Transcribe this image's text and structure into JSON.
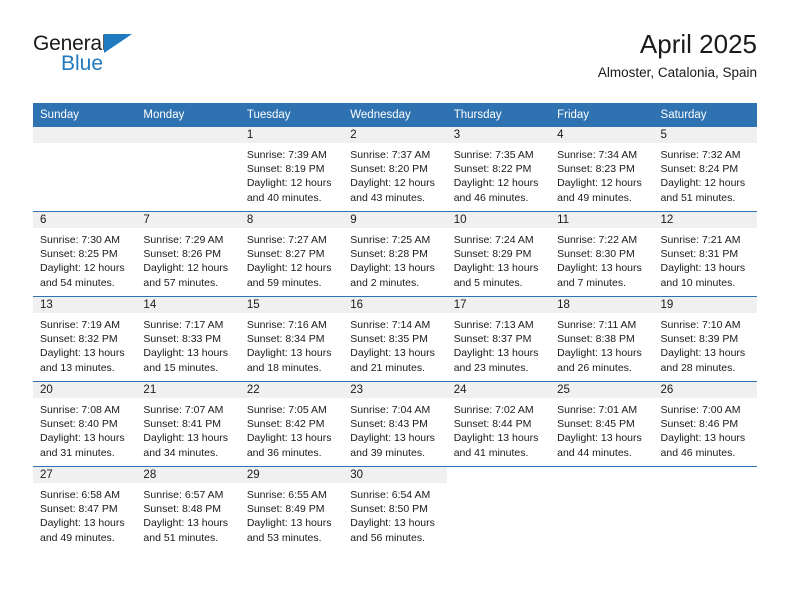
{
  "brand": {
    "name_top": "General",
    "name_bottom": "Blue",
    "accent_color": "#1f7ac0"
  },
  "header": {
    "title": "April 2025",
    "subtitle": "Almoster, Catalonia, Spain"
  },
  "theme": {
    "header_blue": "#2e72b2",
    "daynum_strip": "#f0f0f0",
    "text": "#1a1a1a"
  },
  "calendar": {
    "weekday_headers": [
      "Sunday",
      "Monday",
      "Tuesday",
      "Wednesday",
      "Thursday",
      "Friday",
      "Saturday"
    ],
    "weeks": [
      [
        {
          "day": "",
          "lines": [],
          "empty": true
        },
        {
          "day": "",
          "lines": [],
          "empty": true
        },
        {
          "day": "1",
          "lines": [
            "Sunrise: 7:39 AM",
            "Sunset: 8:19 PM",
            "Daylight: 12 hours",
            "and 40 minutes."
          ]
        },
        {
          "day": "2",
          "lines": [
            "Sunrise: 7:37 AM",
            "Sunset: 8:20 PM",
            "Daylight: 12 hours",
            "and 43 minutes."
          ]
        },
        {
          "day": "3",
          "lines": [
            "Sunrise: 7:35 AM",
            "Sunset: 8:22 PM",
            "Daylight: 12 hours",
            "and 46 minutes."
          ]
        },
        {
          "day": "4",
          "lines": [
            "Sunrise: 7:34 AM",
            "Sunset: 8:23 PM",
            "Daylight: 12 hours",
            "and 49 minutes."
          ]
        },
        {
          "day": "5",
          "lines": [
            "Sunrise: 7:32 AM",
            "Sunset: 8:24 PM",
            "Daylight: 12 hours",
            "and 51 minutes."
          ]
        }
      ],
      [
        {
          "day": "6",
          "lines": [
            "Sunrise: 7:30 AM",
            "Sunset: 8:25 PM",
            "Daylight: 12 hours",
            "and 54 minutes."
          ]
        },
        {
          "day": "7",
          "lines": [
            "Sunrise: 7:29 AM",
            "Sunset: 8:26 PM",
            "Daylight: 12 hours",
            "and 57 minutes."
          ]
        },
        {
          "day": "8",
          "lines": [
            "Sunrise: 7:27 AM",
            "Sunset: 8:27 PM",
            "Daylight: 12 hours",
            "and 59 minutes."
          ]
        },
        {
          "day": "9",
          "lines": [
            "Sunrise: 7:25 AM",
            "Sunset: 8:28 PM",
            "Daylight: 13 hours",
            "and 2 minutes."
          ]
        },
        {
          "day": "10",
          "lines": [
            "Sunrise: 7:24 AM",
            "Sunset: 8:29 PM",
            "Daylight: 13 hours",
            "and 5 minutes."
          ]
        },
        {
          "day": "11",
          "lines": [
            "Sunrise: 7:22 AM",
            "Sunset: 8:30 PM",
            "Daylight: 13 hours",
            "and 7 minutes."
          ]
        },
        {
          "day": "12",
          "lines": [
            "Sunrise: 7:21 AM",
            "Sunset: 8:31 PM",
            "Daylight: 13 hours",
            "and 10 minutes."
          ]
        }
      ],
      [
        {
          "day": "13",
          "lines": [
            "Sunrise: 7:19 AM",
            "Sunset: 8:32 PM",
            "Daylight: 13 hours",
            "and 13 minutes."
          ]
        },
        {
          "day": "14",
          "lines": [
            "Sunrise: 7:17 AM",
            "Sunset: 8:33 PM",
            "Daylight: 13 hours",
            "and 15 minutes."
          ]
        },
        {
          "day": "15",
          "lines": [
            "Sunrise: 7:16 AM",
            "Sunset: 8:34 PM",
            "Daylight: 13 hours",
            "and 18 minutes."
          ]
        },
        {
          "day": "16",
          "lines": [
            "Sunrise: 7:14 AM",
            "Sunset: 8:35 PM",
            "Daylight: 13 hours",
            "and 21 minutes."
          ]
        },
        {
          "day": "17",
          "lines": [
            "Sunrise: 7:13 AM",
            "Sunset: 8:37 PM",
            "Daylight: 13 hours",
            "and 23 minutes."
          ]
        },
        {
          "day": "18",
          "lines": [
            "Sunrise: 7:11 AM",
            "Sunset: 8:38 PM",
            "Daylight: 13 hours",
            "and 26 minutes."
          ]
        },
        {
          "day": "19",
          "lines": [
            "Sunrise: 7:10 AM",
            "Sunset: 8:39 PM",
            "Daylight: 13 hours",
            "and 28 minutes."
          ]
        }
      ],
      [
        {
          "day": "20",
          "lines": [
            "Sunrise: 7:08 AM",
            "Sunset: 8:40 PM",
            "Daylight: 13 hours",
            "and 31 minutes."
          ]
        },
        {
          "day": "21",
          "lines": [
            "Sunrise: 7:07 AM",
            "Sunset: 8:41 PM",
            "Daylight: 13 hours",
            "and 34 minutes."
          ]
        },
        {
          "day": "22",
          "lines": [
            "Sunrise: 7:05 AM",
            "Sunset: 8:42 PM",
            "Daylight: 13 hours",
            "and 36 minutes."
          ]
        },
        {
          "day": "23",
          "lines": [
            "Sunrise: 7:04 AM",
            "Sunset: 8:43 PM",
            "Daylight: 13 hours",
            "and 39 minutes."
          ]
        },
        {
          "day": "24",
          "lines": [
            "Sunrise: 7:02 AM",
            "Sunset: 8:44 PM",
            "Daylight: 13 hours",
            "and 41 minutes."
          ]
        },
        {
          "day": "25",
          "lines": [
            "Sunrise: 7:01 AM",
            "Sunset: 8:45 PM",
            "Daylight: 13 hours",
            "and 44 minutes."
          ]
        },
        {
          "day": "26",
          "lines": [
            "Sunrise: 7:00 AM",
            "Sunset: 8:46 PM",
            "Daylight: 13 hours",
            "and 46 minutes."
          ]
        }
      ],
      [
        {
          "day": "27",
          "lines": [
            "Sunrise: 6:58 AM",
            "Sunset: 8:47 PM",
            "Daylight: 13 hours",
            "and 49 minutes."
          ]
        },
        {
          "day": "28",
          "lines": [
            "Sunrise: 6:57 AM",
            "Sunset: 8:48 PM",
            "Daylight: 13 hours",
            "and 51 minutes."
          ]
        },
        {
          "day": "29",
          "lines": [
            "Sunrise: 6:55 AM",
            "Sunset: 8:49 PM",
            "Daylight: 13 hours",
            "and 53 minutes."
          ]
        },
        {
          "day": "30",
          "lines": [
            "Sunrise: 6:54 AM",
            "Sunset: 8:50 PM",
            "Daylight: 13 hours",
            "and 56 minutes."
          ]
        },
        {
          "day": "",
          "lines": [],
          "blank": true
        },
        {
          "day": "",
          "lines": [],
          "blank": true
        },
        {
          "day": "",
          "lines": [],
          "blank": true
        }
      ]
    ]
  }
}
